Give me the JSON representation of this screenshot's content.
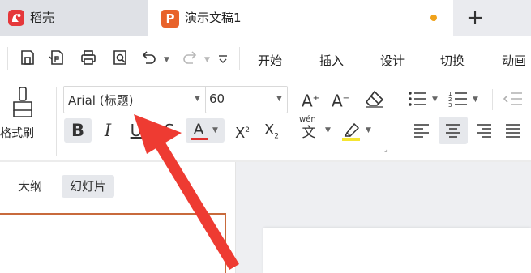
{
  "tabs": {
    "docer": {
      "label": "稻壳"
    },
    "document": {
      "label": "演示文稿1",
      "logo_letter": "P",
      "unsaved": true
    },
    "new_tab": "+"
  },
  "ribbon_tabs": [
    "开始",
    "插入",
    "设计",
    "切换",
    "动画"
  ],
  "format_painter": {
    "label": "格式刷"
  },
  "font": {
    "family": "Arial (标题)",
    "size": "60"
  },
  "phonetic_label": "wén",
  "side_pane": {
    "tabs": [
      "大纲",
      "幻灯片"
    ],
    "active": "幻灯片"
  },
  "colors": {
    "accent": "#e8622a",
    "docer_red": "#e5373a",
    "font_color_underline": "#e0312e",
    "highlight_yellow": "#f5e531",
    "annotation_arrow": "#ee3b32",
    "slide_border": "#c86a3c"
  },
  "icons": {
    "quick_access": [
      "save-icon",
      "export-pdf-icon",
      "print-icon",
      "print-preview-icon",
      "undo-icon",
      "redo-icon",
      "customize-dropdown-icon"
    ],
    "ribbon": [
      "increase-font-icon",
      "decrease-font-icon",
      "clear-format-icon",
      "bullets-icon",
      "numbering-icon",
      "decrease-indent-icon",
      "bold-icon",
      "italic-icon",
      "underline-icon",
      "strikethrough-icon",
      "font-color-icon",
      "superscript-icon",
      "subscript-icon",
      "phonetic-guide-icon",
      "highlight-icon",
      "align-left-icon",
      "align-center-icon",
      "align-right-icon",
      "justify-icon"
    ]
  }
}
